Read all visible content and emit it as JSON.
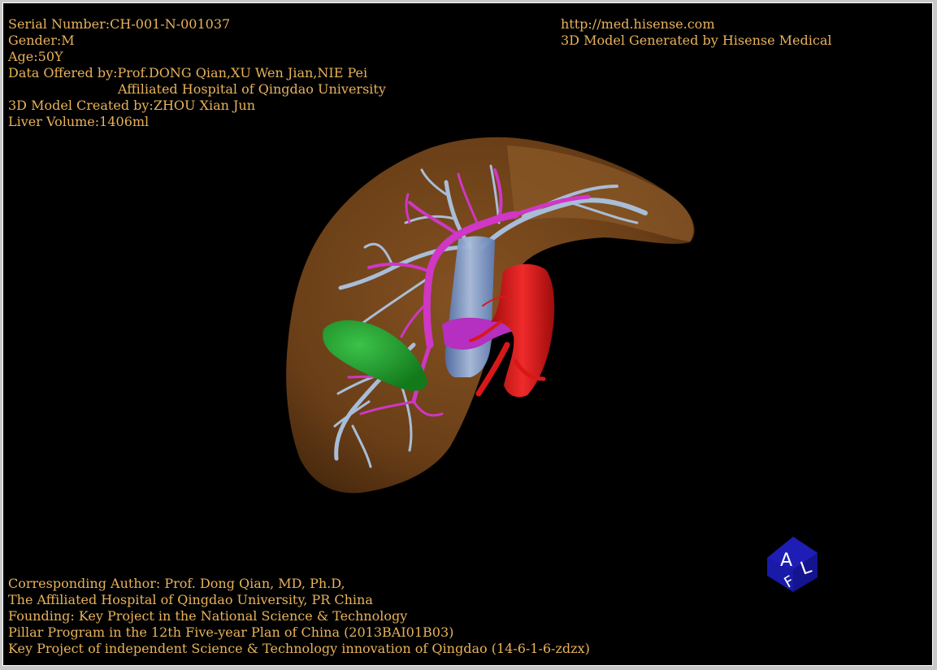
{
  "patient_info": {
    "serial": "Serial Number:CH-001-N-001037",
    "gender": "Gender:M",
    "age": "Age:50Y",
    "data_offered": "Data Offered by:Prof.DONG Qian,XU Wen Jian,NIE Pei",
    "hospital": "Affiliated Hospital of Qingdao University",
    "model_created": "3D Model Created by:ZHOU Xian Jun",
    "liver_volume": "Liver Volume:1406ml"
  },
  "site_info": {
    "url": "http://med.hisense.com",
    "generator": "3D Model Generated by Hisense Medical"
  },
  "credits": {
    "line1": "Corresponding Author: Prof. Dong Qian, MD, Ph.D,",
    "line2": "The Affiliated Hospital of Qingdao University, PR China",
    "line3": "Founding: Key Project in the National Science & Technology",
    "line4": "Pillar Program in the 12th Five-year Plan of China (2013BAI01B03)",
    "line5": "Key Project of independent Science & Technology innovation of Qingdao (14-6-1-6-zdzx)"
  },
  "orientation_cube": {
    "face_top": "A",
    "face_right": "L",
    "face_front": "F",
    "color": "#1a1aa8"
  },
  "colors": {
    "text": "#e8b25a",
    "liver": "#7a4a1e",
    "hepatic_vein": "#9fb6d8",
    "portal_vein": "#d23ac8",
    "gallbladder": "#1f9a2a",
    "aorta": "#d81818",
    "vena_cava": "#6f8fc8"
  }
}
